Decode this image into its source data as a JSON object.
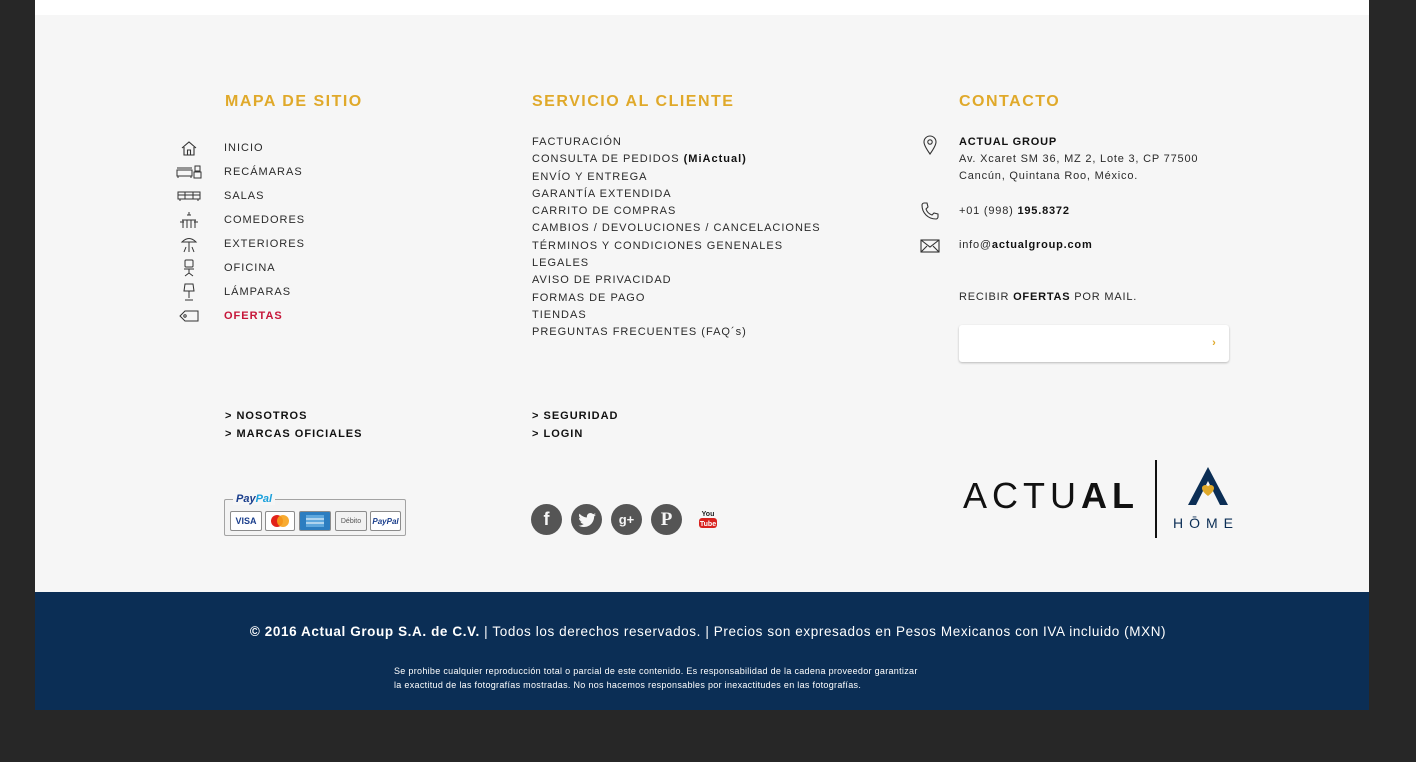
{
  "sitemap": {
    "title": "MAPA DE SITIO",
    "items": [
      {
        "label": "INICIO",
        "icon": "home-icon"
      },
      {
        "label": "RECÁMARAS",
        "icon": "bed-icon"
      },
      {
        "label": "SALAS",
        "icon": "sofa-icon"
      },
      {
        "label": "COMEDORES",
        "icon": "dining-table-icon"
      },
      {
        "label": "EXTERIORES",
        "icon": "umbrella-icon"
      },
      {
        "label": "OFICINA",
        "icon": "office-chair-icon"
      },
      {
        "label": "LÁMPARAS",
        "icon": "lamp-icon"
      },
      {
        "label": "OFERTAS",
        "icon": "tag-icon"
      }
    ],
    "offer_color": "#c61639"
  },
  "service": {
    "title": "SERVICIO AL CLIENTE",
    "items": [
      "FACTURACIÓN",
      "CONSULTA DE PEDIDOS",
      "ENVÍO Y ENTREGA",
      "GARANTÍA EXTENDIDA",
      "CARRITO DE COMPRAS",
      "CAMBIOS / DEVOLUCIONES / CANCELACIONES",
      "TÉRMINOS Y CONDICIONES GENENALES",
      "LEGALES",
      "AVISO DE PRIVACIDAD",
      "FORMAS DE PAGO",
      "TIENDAS",
      "PREGUNTAS FRECUENTES (FAQ´s)"
    ],
    "pedidos_suffix": "(MiActual)"
  },
  "contact": {
    "title": "CONTACTO",
    "company": "ACTUAL GROUP",
    "address_line1": "Av. Xcaret SM 36, MZ 2, Lote 3, CP 77500",
    "address_line2": "Cancún, Quintana Roo, México.",
    "phone_prefix": "+01 (998)",
    "phone_number": "195.8372",
    "email_user": "info@",
    "email_domain": "actualgroup.com",
    "offers_pre": "RECIBIR",
    "offers_bold": "OFERTAS",
    "offers_post": "POR MAIL.",
    "newsletter_placeholder": "",
    "newsletter_button": "›"
  },
  "links": {
    "nosotros": "> NOSOTROS",
    "marcas": "> MARCAS OFICIALES",
    "seguridad": "> SEGURIDAD",
    "login": "> LOGIN"
  },
  "payments": {
    "logo_a": "Pay",
    "logo_b": "Pal",
    "cards": [
      "VISA",
      "MasterCard",
      "AMEX",
      "Débito",
      "PayPal"
    ]
  },
  "social": [
    {
      "name": "facebook-icon",
      "glyph": "f"
    },
    {
      "name": "twitter-icon",
      "glyph": "t"
    },
    {
      "name": "google-plus-icon",
      "glyph": "g+"
    },
    {
      "name": "pinterest-icon",
      "glyph": "P"
    },
    {
      "name": "youtube-icon",
      "glyph": "You Tube"
    }
  ],
  "brand": {
    "word_light": "ACTU",
    "word_bold": "AL",
    "home": "HŌME",
    "navy": "#0b2e55",
    "gold": "#e0a92a"
  },
  "footer": {
    "copyright_bold": "© 2016 Actual Group S.A. de C.V.",
    "copyright_rest": "| Todos los derechos reservados. | Precios son expresados en Pesos Mexicanos con IVA incluido (MXN)",
    "disclaimer_line1": "Se prohibe cualquier reproducción total o parcial de este contenido. Es responsabilidad de la cadena proveedor garantizar",
    "disclaimer_line2": "la exactitud de las fotografías mostradas. No nos hacemos responsables por inexactitudes en las fotografías."
  }
}
